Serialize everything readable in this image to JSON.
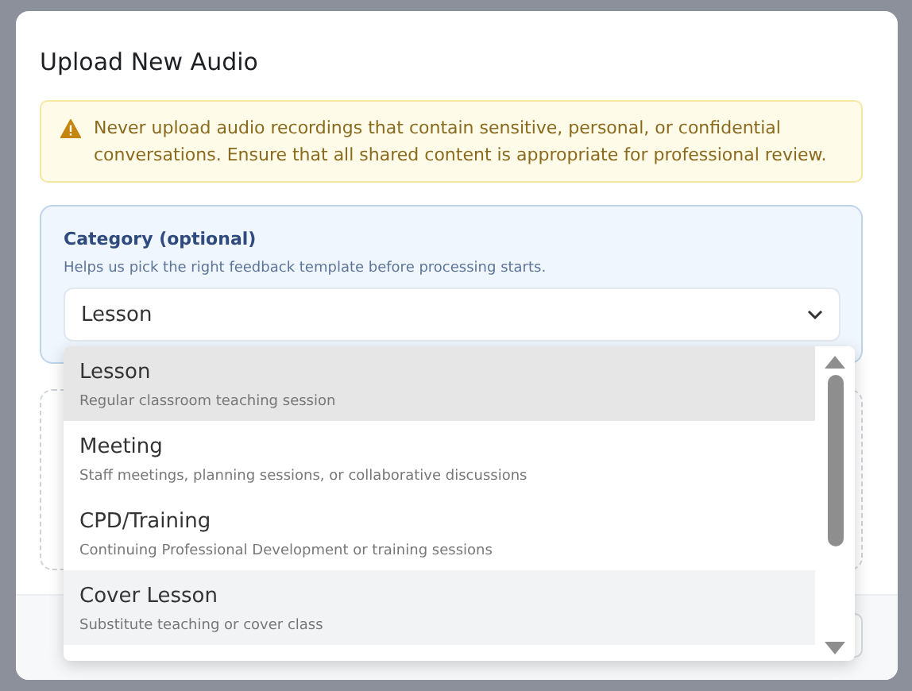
{
  "dialog": {
    "title": "Upload New Audio"
  },
  "warning": {
    "text": "Never upload audio recordings that contain sensitive, personal, or confidential conversations. Ensure that all shared content is appropriate for professional review."
  },
  "category": {
    "label": "Category (optional)",
    "hint": "Helps us pick the right feedback template before processing starts.",
    "value": "Lesson",
    "expanded": true,
    "options": [
      {
        "label": "Lesson",
        "description": "Regular classroom teaching session",
        "selected": true,
        "highlighted": false
      },
      {
        "label": "Meeting",
        "description": "Staff meetings, planning sessions, or collaborative discussions",
        "selected": false,
        "highlighted": false
      },
      {
        "label": "CPD/Training",
        "description": "Continuing Professional Development or training sessions",
        "selected": false,
        "highlighted": false
      },
      {
        "label": "Cover Lesson",
        "description": "Substitute teaching or cover class",
        "selected": false,
        "highlighted": true
      }
    ]
  }
}
